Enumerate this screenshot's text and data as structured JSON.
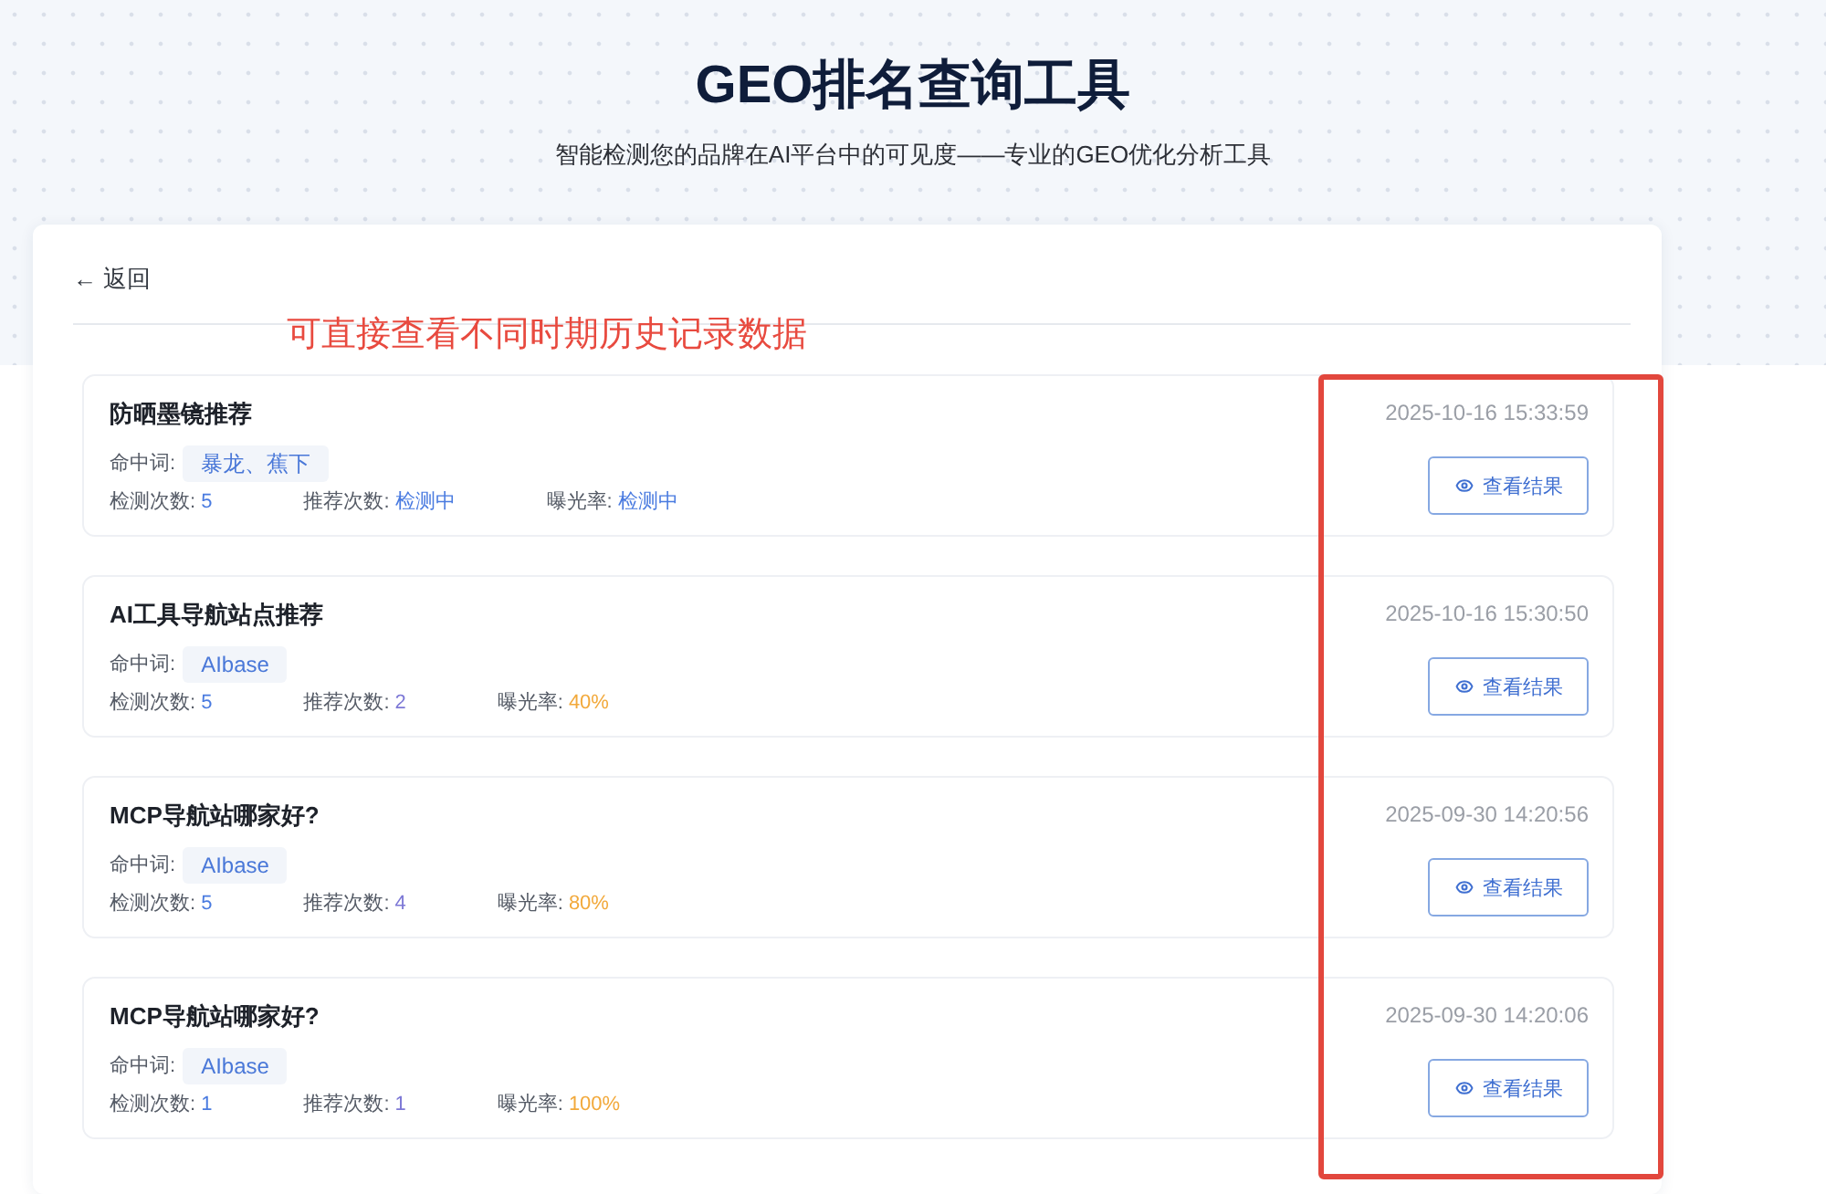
{
  "header": {
    "title": "GEO排名查询工具",
    "subtitle": "智能检测您的品牌在AI平台中的可见度——专业的GEO优化分析工具"
  },
  "panel": {
    "back_link": "← 返回"
  },
  "annotation": {
    "note": "可直接查看不同时期历史记录数据",
    "frame": true
  },
  "records": [
    {
      "title": "防晒墨镜推荐",
      "hit_label": "命中词:",
      "hit_words": "暴龙、蕉下",
      "stats": [
        {
          "label": "检测次数:",
          "value": "5",
          "color": "#4a7be0"
        },
        {
          "label": "推荐次数:",
          "value": "检测中",
          "color": "#4a7be0"
        },
        {
          "label": "曝光率:",
          "value": "检测中",
          "color": "#4a7be0"
        }
      ],
      "time": "2025-10-16 15:33:59",
      "button": "查看结果"
    },
    {
      "title": "AI工具导航站点推荐",
      "hit_label": "命中词:",
      "hit_words": "AIbase",
      "stats": [
        {
          "label": "检测次数:",
          "value": "5",
          "color": "#4a7be0"
        },
        {
          "label": "推荐次数:",
          "value": "2",
          "color": "#7d78d6"
        },
        {
          "label": "曝光率:",
          "value": "40%",
          "color": "#f2a93b"
        }
      ],
      "time": "2025-10-16 15:30:50",
      "button": "查看结果"
    },
    {
      "title": "MCP导航站哪家好?",
      "hit_label": "命中词:",
      "hit_words": "AIbase",
      "stats": [
        {
          "label": "检测次数:",
          "value": "5",
          "color": "#4a7be0"
        },
        {
          "label": "推荐次数:",
          "value": "4",
          "color": "#7d78d6"
        },
        {
          "label": "曝光率:",
          "value": "80%",
          "color": "#f2a93b"
        }
      ],
      "time": "2025-09-30 14:20:56",
      "button": "查看结果"
    },
    {
      "title": "MCP导航站哪家好?",
      "hit_label": "命中词:",
      "hit_words": "AIbase",
      "stats": [
        {
          "label": "检测次数:",
          "value": "1",
          "color": "#4a7be0"
        },
        {
          "label": "推荐次数:",
          "value": "1",
          "color": "#7d78d6"
        },
        {
          "label": "曝光率:",
          "value": "100%",
          "color": "#f2a93b"
        }
      ],
      "time": "2025-09-30 14:20:06",
      "button": "查看结果"
    }
  ]
}
